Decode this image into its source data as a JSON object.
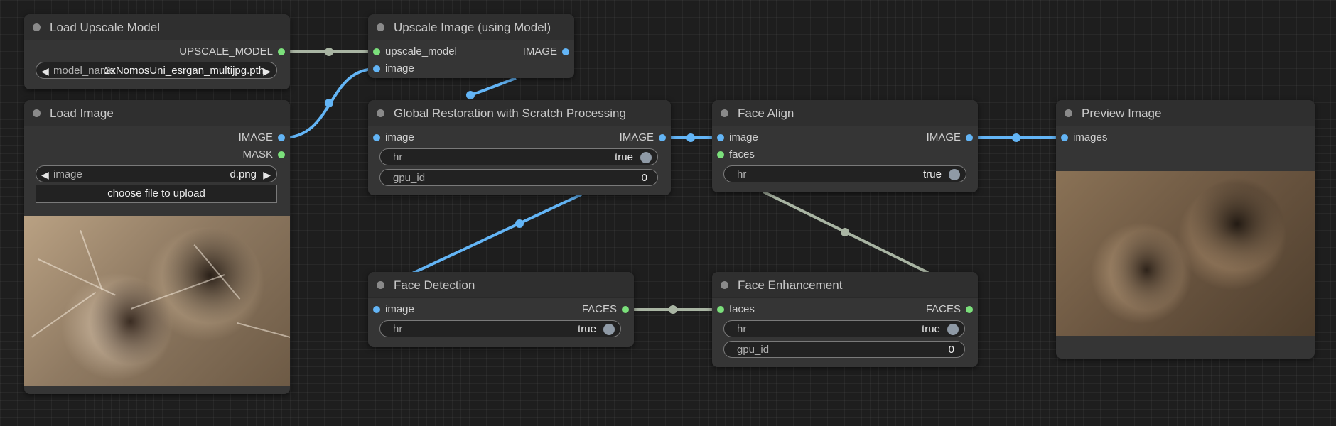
{
  "nodes": {
    "load_upscale_model": {
      "title": "Load Upscale Model",
      "outputs": [
        "UPSCALE_MODEL"
      ],
      "widget": {
        "label": "model_name",
        "value": "2xNomosUni_esrgan_multijpg.pth"
      }
    },
    "load_image": {
      "title": "Load Image",
      "outputs": [
        "IMAGE",
        "MASK"
      ],
      "widget": {
        "label": "image",
        "value": "d.png"
      },
      "upload_label": "choose file to upload"
    },
    "upscale_image": {
      "title": "Upscale Image (using Model)",
      "inputs": [
        "upscale_model",
        "image"
      ],
      "outputs": [
        "IMAGE"
      ]
    },
    "global_restoration": {
      "title": "Global Restoration with Scratch Processing",
      "inputs": [
        "image"
      ],
      "outputs": [
        "IMAGE"
      ],
      "widgets": [
        {
          "label": "hr",
          "value": "true"
        },
        {
          "label": "gpu_id",
          "value": "0"
        }
      ]
    },
    "face_align": {
      "title": "Face Align",
      "inputs": [
        "image",
        "faces"
      ],
      "outputs": [
        "IMAGE"
      ],
      "widgets": [
        {
          "label": "hr",
          "value": "true"
        }
      ]
    },
    "preview_image": {
      "title": "Preview Image",
      "inputs": [
        "images"
      ]
    },
    "face_detection": {
      "title": "Face Detection",
      "inputs": [
        "image"
      ],
      "outputs": [
        "FACES"
      ],
      "widgets": [
        {
          "label": "hr",
          "value": "true"
        }
      ]
    },
    "face_enhancement": {
      "title": "Face Enhancement",
      "inputs": [
        "faces"
      ],
      "outputs": [
        "FACES"
      ],
      "widgets": [
        {
          "label": "hr",
          "value": "true"
        },
        {
          "label": "gpu_id",
          "value": "0"
        }
      ]
    }
  },
  "colors": {
    "image_link": "#63b5f6",
    "model_link": "#a9b5a3",
    "faces_link": "#a9b5a3",
    "node_bg": "#353535",
    "canvas_bg": "#1e1e1e"
  }
}
